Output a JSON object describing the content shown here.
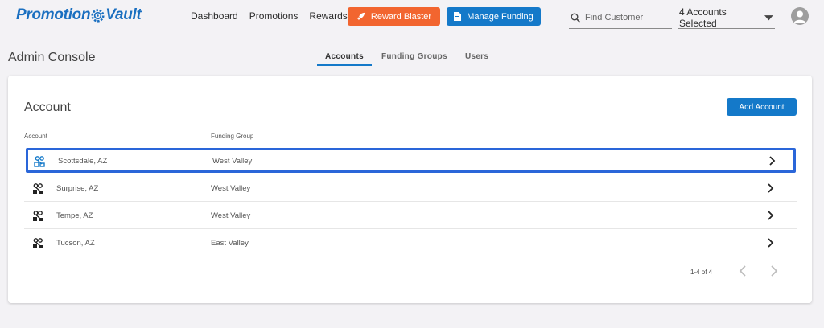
{
  "header": {
    "logo_left": "Promotion",
    "logo_right": "Vault",
    "nav": [
      "Dashboard",
      "Promotions",
      "Rewards"
    ],
    "reward_blaster_label": "Reward Blaster",
    "manage_funding_label": "Manage Funding",
    "search_placeholder": "Find Customer",
    "accounts_selected": "4 Accounts Selected"
  },
  "page": {
    "title": "Admin Console",
    "tabs": [
      {
        "label": "Accounts",
        "active": true
      },
      {
        "label": "Funding Groups",
        "active": false
      },
      {
        "label": "Users",
        "active": false
      }
    ]
  },
  "card": {
    "title": "Account",
    "add_button_label": "Add Account",
    "columns": [
      "Account",
      "Funding Group"
    ],
    "rows": [
      {
        "account": "Scottsdale, AZ",
        "funding_group": "West Valley",
        "selected": true
      },
      {
        "account": "Surprise, AZ",
        "funding_group": "West Valley",
        "selected": false
      },
      {
        "account": "Tempe, AZ",
        "funding_group": "West Valley",
        "selected": false
      },
      {
        "account": "Tucson, AZ",
        "funding_group": "East Valley",
        "selected": false
      }
    ],
    "pagination": "1-4 of 4"
  },
  "icons": {
    "rocket": "rocket-icon",
    "document": "document-icon",
    "search": "search-icon",
    "dropdown": "caret-down-icon",
    "avatar": "user-avatar-icon",
    "account": "store-icon",
    "chevron": "chevron-right-icon"
  },
  "colors": {
    "brand_blue": "#1479c9",
    "orange": "#f2652f",
    "selection_border": "#2a66d9",
    "background": "#f3f2f5"
  }
}
